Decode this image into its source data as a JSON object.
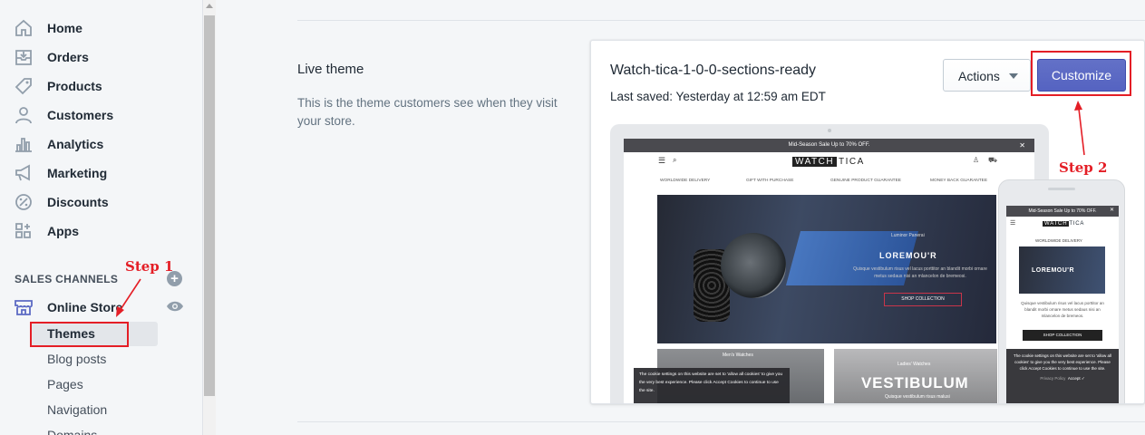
{
  "sidebar": {
    "items": [
      {
        "label": "Home",
        "icon": "home-icon"
      },
      {
        "label": "Orders",
        "icon": "orders-icon"
      },
      {
        "label": "Products",
        "icon": "tag-icon"
      },
      {
        "label": "Customers",
        "icon": "person-icon"
      },
      {
        "label": "Analytics",
        "icon": "bar-chart-icon"
      },
      {
        "label": "Marketing",
        "icon": "megaphone-icon"
      },
      {
        "label": "Discounts",
        "icon": "discount-icon"
      },
      {
        "label": "Apps",
        "icon": "apps-icon"
      }
    ],
    "sales_channels_title": "SALES CHANNELS",
    "online_store": "Online Store",
    "sub_items": [
      "Themes",
      "Blog posts",
      "Pages",
      "Navigation",
      "Domains"
    ]
  },
  "live_theme": {
    "title": "Live theme",
    "description": "This is the theme customers see when they visit your store."
  },
  "theme_card": {
    "name": "Watch-tica-1-0-0-sections-ready",
    "last_saved": "Last saved: Yesterday at 12:59 am EDT",
    "actions_label": "Actions",
    "customize_label": "Customize"
  },
  "preview": {
    "promo": "Mid-Season Sale Up to 70% OFF.",
    "logo_dark": "WATCH",
    "logo_light": "TICA",
    "features": [
      "WORLDWIDE DELIVERY",
      "GIFT WITH PURCHASE",
      "GENUINE PRODUCT GUARANTEE",
      "MONEY BACK GUARANTEE"
    ],
    "hero_sub": "Luminor Panerai",
    "hero_title": "LOREMOU'R",
    "hero_text": "Quisque vestibulum risus vel lacus porttitor an blandit morbi ornare metus sedaus nisi an mlancelon de bremeosi.",
    "hero_button": "SHOP COLLECTION",
    "tile1_label": "Men's Watches",
    "tile2_label": "Ladies' Watches",
    "tile2_title": "VESTIBULUM",
    "tile2_sub": "Quisque vestibulum risus malusi",
    "cookie_text": "The cookie settings on this website are set to 'allow all cookies' to give you the very best experience. Please click Accept Cookies to continue to use the site.",
    "privacy": "Privacy Policy",
    "accept": "Accept ✓",
    "mobile_delivery": "WORLDWIDE DELIVERY",
    "mobile_hero_title": "LOREMOU'R",
    "mobile_text": "Quisque vestibulum risus vel lacus porttitor an blandit morbi ornare metus sedaus nisi an mlancelon de bremeos.",
    "mobile_button": "SHOP COLLECTION",
    "mobile_cookie": "The cookie settings on this website are set to 'allow all cookies' to give you the very best experience. Please click Accept Cookies to continue to use the site."
  },
  "annotations": {
    "step1": "Step 1",
    "step2": "Step 2",
    "color": "#e41e26"
  },
  "colors": {
    "primary_button": "#5c6ac4",
    "sidebar_bg": "#f4f6f8"
  }
}
